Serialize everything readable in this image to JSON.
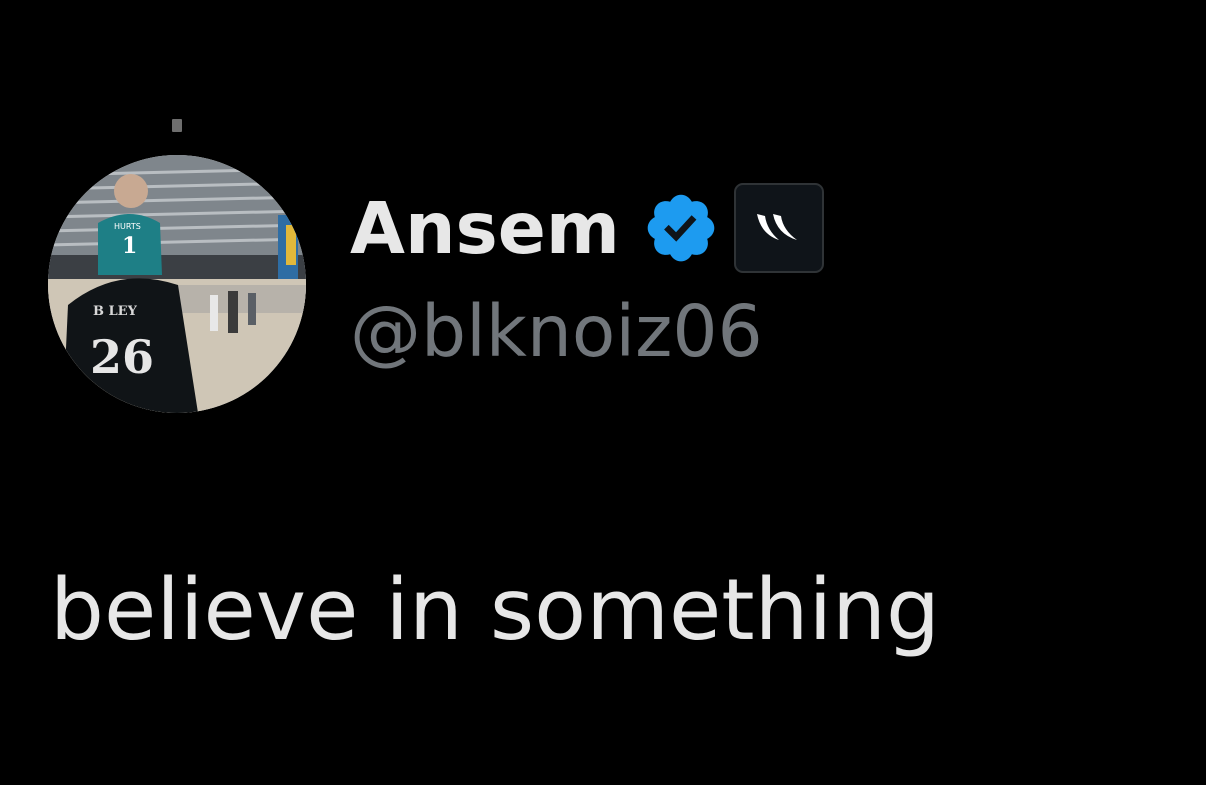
{
  "tweet": {
    "author": {
      "display_name": "Ansem",
      "handle": "@blknoiz06",
      "verified": true,
      "avatar_icon": "avatar-photo"
    },
    "text": "believe in something"
  },
  "colors": {
    "background": "#000000",
    "primary_text": "#e7e7e7",
    "secondary_text": "#71767b",
    "verified_blue": "#1d9bf0",
    "badge_background": "#0f1419"
  }
}
